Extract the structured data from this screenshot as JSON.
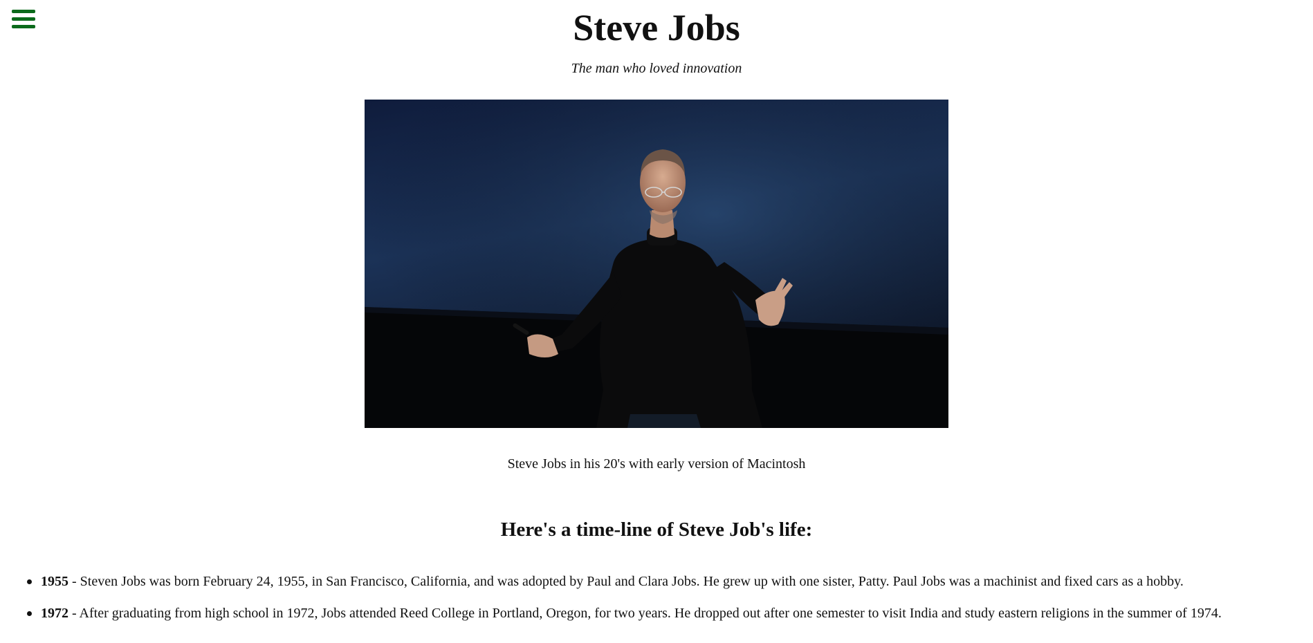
{
  "header": {
    "menu_icon": "hamburger-menu-icon",
    "title": "Steve Jobs",
    "tagline": "The man who loved innovation"
  },
  "hero": {
    "caption": "Steve Jobs in his 20's with early version of Macintosh"
  },
  "timeline": {
    "heading": "Here's a time-line of Steve Job's life:",
    "items": [
      {
        "year": "1955",
        "text": " - Steven Jobs was born February 24, 1955, in San Francisco, California, and was adopted by Paul and Clara Jobs. He grew up with one sister, Patty. Paul Jobs was a machinist and fixed cars as a hobby."
      },
      {
        "year": "1972",
        "text": " - After graduating from high school in 1972, Jobs attended Reed College in Portland, Oregon, for two years. He dropped out after one semester to visit India and study eastern religions in the summer of 1974."
      }
    ]
  },
  "colors": {
    "menu_icon": "#0b6a1b",
    "text": "#111111",
    "background": "#ffffff"
  }
}
